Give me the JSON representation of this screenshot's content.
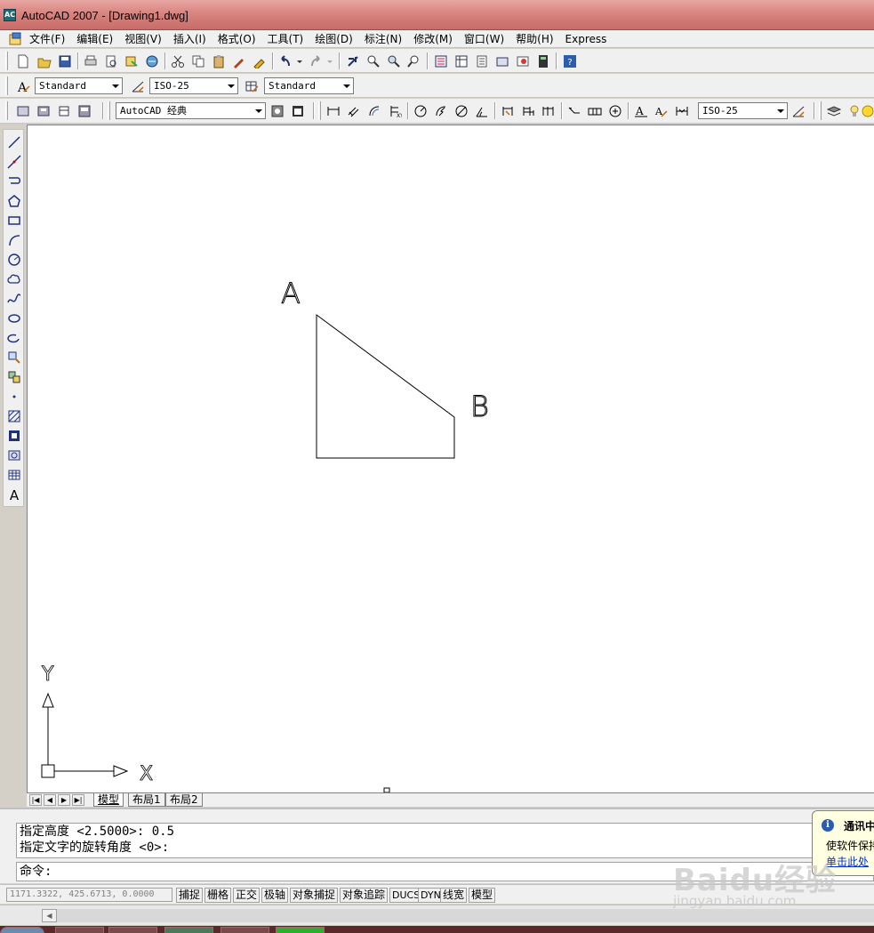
{
  "window": {
    "title": "AutoCAD 2007 - [Drawing1.dwg]",
    "app_icon_label": "AC"
  },
  "menu": {
    "items": [
      "文件(F)",
      "编辑(E)",
      "视图(V)",
      "插入(I)",
      "格式(O)",
      "工具(T)",
      "绘图(D)",
      "标注(N)",
      "修改(M)",
      "窗口(W)",
      "帮助(H)",
      "Express"
    ]
  },
  "toolbar": {
    "text_style": "Standard",
    "dim_style": "ISO-25",
    "table_style": "Standard",
    "workspace": "AutoCAD 经典",
    "dim_style_2": "ISO-25"
  },
  "drawing": {
    "label_a": "A",
    "label_b": "B",
    "ucs_x": "X",
    "ucs_y": "Y"
  },
  "layout_tabs": {
    "model": "模型",
    "layout1": "布局1",
    "layout2": "布局2"
  },
  "command": {
    "history": [
      "指定高度 <2.5000>: 0.5",
      "指定文字的旋转角度 <0>:"
    ],
    "prompt": "命令:"
  },
  "notification": {
    "title": "通讯中",
    "text": "使软件保持",
    "link": "单击此处"
  },
  "status": {
    "coordinates": "1171.3322,  425.6713,  0.0000",
    "toggles": [
      "捕捉",
      "栅格",
      "正交",
      "极轴",
      "对象捕捉",
      "对象追踪",
      "DUCS",
      "DYN",
      "线宽",
      "模型"
    ]
  },
  "watermark": {
    "brand": "Baidu经验",
    "url": "jingyan.baidu.com"
  },
  "colors": {
    "titlebar": "#d9847f",
    "canvas": "#ffffff",
    "chrome": "#f0f0f0",
    "link": "#0033cc"
  }
}
